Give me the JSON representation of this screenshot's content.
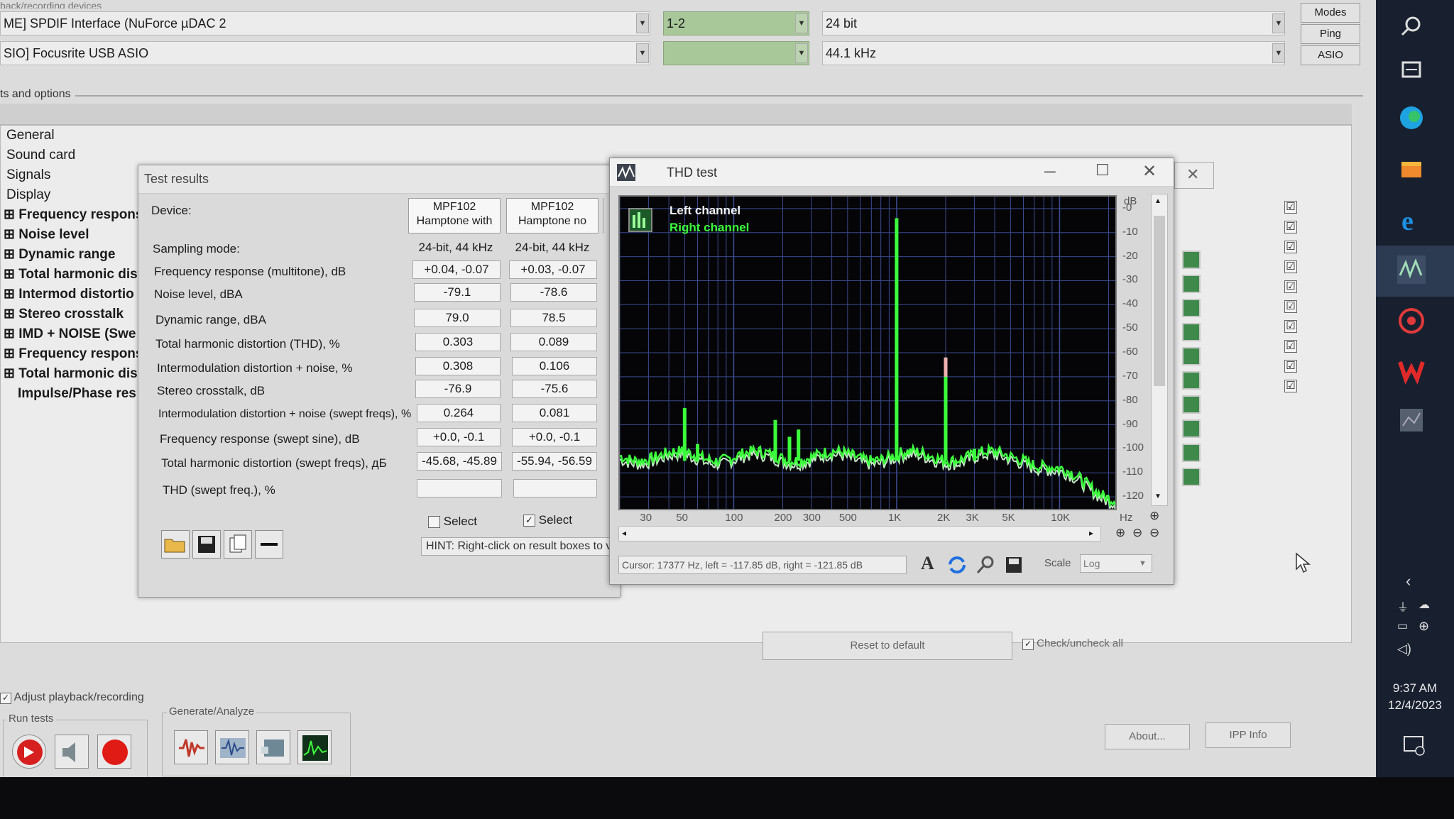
{
  "header": {
    "playback_device": "ME] SPDIF Interface (NuForce µDAC 2",
    "recording_device": "SIO] Focusrite USB ASIO",
    "playback_channels": "1-2",
    "bit_depth": "24 bit",
    "sample_rate": "44.1 kHz",
    "buttons": {
      "modes": "Modes",
      "ping": "Ping",
      "asio": "ASIO"
    },
    "top_cut_label": "back/recording devices"
  },
  "tests": {
    "group_label": "ts and options",
    "items": [
      {
        "label": "General",
        "checked": false
      },
      {
        "label": "Sound card",
        "checked": false
      },
      {
        "label": "Signals",
        "checked": false
      },
      {
        "label": "Display",
        "checked": false
      },
      {
        "label": "Frequency respons",
        "checked": true
      },
      {
        "label": "Noise level",
        "checked": true
      },
      {
        "label": "Dynamic range",
        "checked": true
      },
      {
        "label": "Total harmonic dist",
        "checked": true
      },
      {
        "label": "Intermod distortio",
        "checked": true
      },
      {
        "label": "Stereo crosstalk",
        "checked": true
      },
      {
        "label": "IMD + NOISE (Swe",
        "checked": true
      },
      {
        "label": "Frequency respons",
        "checked": true
      },
      {
        "label": "Total harmonic dist",
        "checked": true
      },
      {
        "label": "Impulse/Phase res",
        "checked": true
      }
    ],
    "check_marks": [
      "☑",
      "☑",
      "☑",
      "☑",
      "☑",
      "☑",
      "☑",
      "☑",
      "☑",
      "☑"
    ]
  },
  "results_window": {
    "title": "Test results",
    "device_label": "Device:",
    "devices": [
      {
        "line1": "MPF102",
        "line2": "Hamptone with"
      },
      {
        "line1": "MPF102",
        "line2": "Hamptone no"
      }
    ],
    "rows": [
      {
        "label": "Sampling mode:",
        "v1": "24-bit, 44 kHz",
        "v2": "24-bit, 44 kHz"
      },
      {
        "label": "Frequency response (multitone), dB",
        "v1": "+0.04, -0.07",
        "v2": "+0.03, -0.07"
      },
      {
        "label": "Noise level, dBA",
        "v1": "-79.1",
        "v2": "-78.6"
      },
      {
        "label": "Dynamic range, dBA",
        "v1": "79.0",
        "v2": "78.5"
      },
      {
        "label": "Total harmonic distortion (THD), %",
        "v1": "0.303",
        "v2": "0.089"
      },
      {
        "label": "Intermodulation distortion + noise, %",
        "v1": "0.308",
        "v2": "0.106"
      },
      {
        "label": "Stereo crosstalk, dB",
        "v1": "-76.9",
        "v2": "-75.6"
      },
      {
        "label": "Intermodulation distortion + noise (swept freqs), %",
        "v1": "0.264",
        "v2": "0.081"
      },
      {
        "label": "Frequency response (swept sine), dB",
        "v1": "+0.0, -0.1",
        "v2": "+0.0, -0.1"
      },
      {
        "label": "Total harmonic distortion (swept freqs), дБ",
        "v1": "-45.68, -45.89",
        "v2": "-55.94, -56.59"
      },
      {
        "label": "THD (swept freq.), %",
        "v1": "",
        "v2": ""
      }
    ],
    "select_label": "Select",
    "select_states": [
      false,
      true
    ],
    "hint": "HINT: Right-click on result boxes to vi"
  },
  "thd_window": {
    "title": "THD test",
    "legend_left": "Left channel",
    "legend_right": "Right channel",
    "y_unit": "dB",
    "y_ticks": [
      "-0",
      "-10",
      "-20",
      "-30",
      "-40",
      "-50",
      "-60",
      "-70",
      "-80",
      "-90",
      "-100",
      "-110",
      "-120"
    ],
    "x_ticks": [
      "30",
      "50",
      "100",
      "200",
      "300",
      "500",
      "1K",
      "2K",
      "3K",
      "5K",
      "10K"
    ],
    "x_unit": "Hz",
    "cursor": "Cursor:  17377 Hz,  left = -117.85 dB,  right = -121.85 dB",
    "scale_label": "Scale",
    "scale_value": "Log"
  },
  "bottom": {
    "reset_button": "Reset to default",
    "check_all": "Check/uncheck all",
    "adjust_label": "Adjust playback/recording",
    "run_tests_label": "Run tests",
    "generate_label": "Generate/Analyze",
    "about_button": "About...",
    "ipp_button": "IPP Info"
  },
  "taskbar": {
    "time": "9:37 AM",
    "date": "12/4/2023"
  },
  "colors": {
    "plot_bg": "#050508",
    "right_channel": "#3cff3c",
    "left_channel": "#d8ffd8",
    "grid": "#3a4a8c"
  }
}
